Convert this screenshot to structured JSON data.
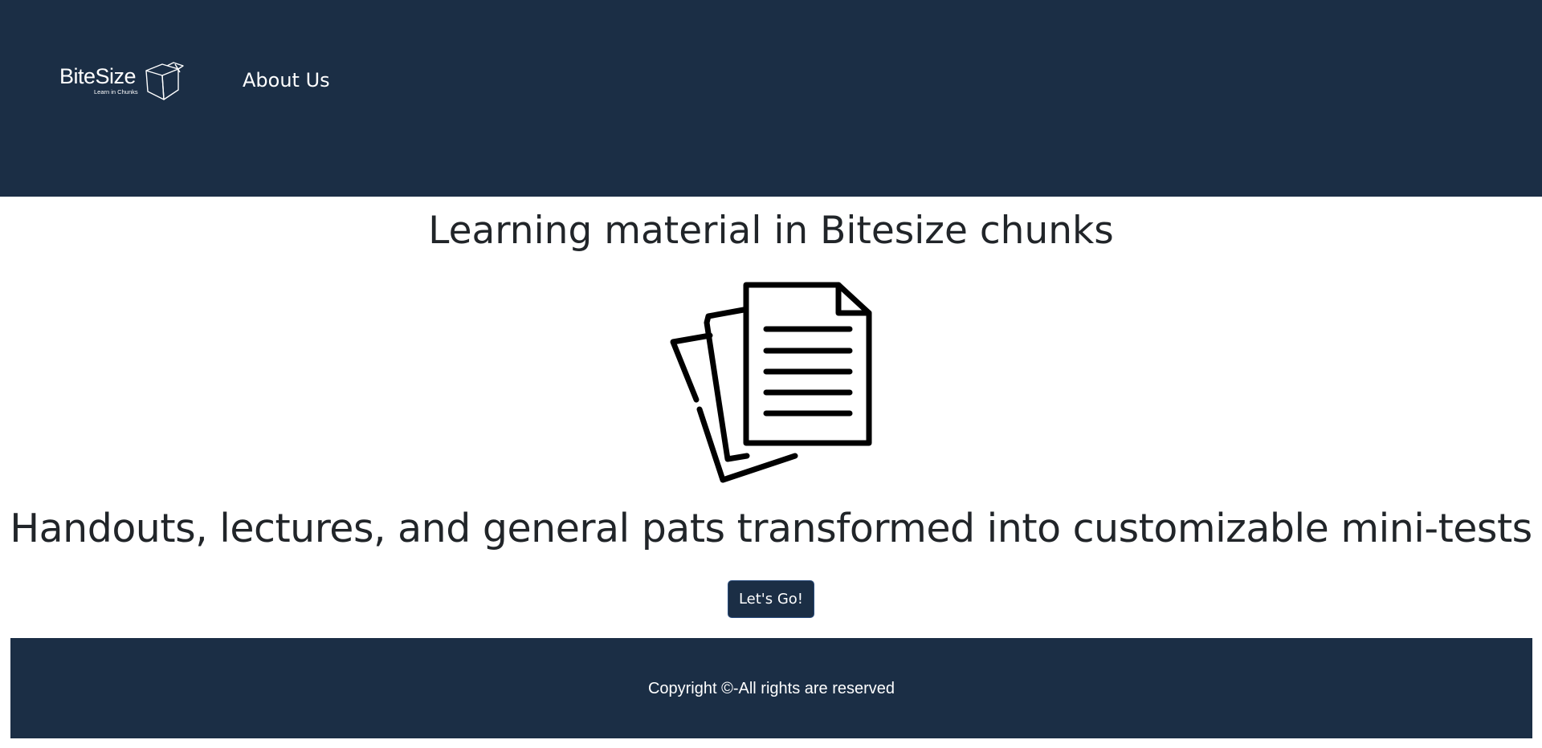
{
  "header": {
    "logo": {
      "name": "BiteSize",
      "tagline": "Learn in Chunks",
      "icon": "box-icon"
    },
    "nav": {
      "about_label": "About Us"
    },
    "background_color": "#1b2e45"
  },
  "hero": {
    "title": "Learning material in Bitesize chunks",
    "icon": "documents-icon",
    "subtitle": "Handouts, lectures, and general pats transformed into customizable mini-tests",
    "cta_label": "Let's Go!"
  },
  "footer": {
    "copyright": "Copyright ©-All rights are reserved"
  },
  "colors": {
    "brand_dark": "#1b2e45",
    "text_dark": "#212529",
    "button_border": "#2a4d7e"
  }
}
